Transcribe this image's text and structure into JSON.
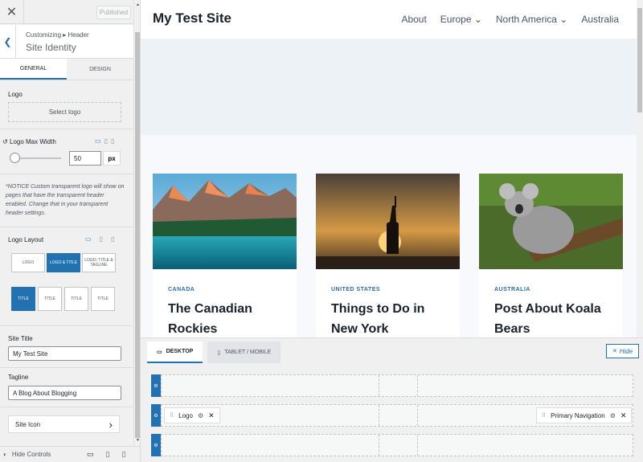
{
  "panel": {
    "close_glyph": "✕",
    "published_label": "Published",
    "back_glyph": "❮",
    "breadcrumb": "Customizing ▸ Header",
    "section_title": "Site Identity",
    "tabs": {
      "general": "GENERAL",
      "design": "DESIGN"
    },
    "logo_label": "Logo",
    "select_logo": "Select logo",
    "logo_max_width_label": "Logo Max Width",
    "logo_max_width_value": "50",
    "unit": "px",
    "notice": "*NOTICE Custom transparent logo will show on pages that have the transparent header enabled. Change that in your transparent header settings.",
    "logo_layout_label": "Logo Layout",
    "layout_options": [
      "LOGO",
      "LOGO & TITLE",
      "LOGO; TITLE & TAGLINE"
    ],
    "align_options": [
      "TITLE",
      "TITLE",
      "TITLE",
      "TITLE"
    ],
    "site_title_label": "Site Title",
    "site_title_value": "My Test Site",
    "tagline_label": "Tagline",
    "tagline_value": "A Blog About Blogging",
    "site_icon_label": "Site Icon",
    "chevron_right": "›",
    "hide_controls": "Hide Controls"
  },
  "site": {
    "title": "My Test Site",
    "nav": [
      "About",
      "Europe ⌄",
      "North America ⌄",
      "Australia"
    ],
    "cards": [
      {
        "category": "CANADA",
        "title": "The Canadian Rockies"
      },
      {
        "category": "UNITED STATES",
        "title": "Things to Do in New York"
      },
      {
        "category": "AUSTRALIA",
        "title": "Post About Koala Bears"
      }
    ]
  },
  "builder": {
    "tab_desktop": "DESKTOP",
    "tab_tablet": "TABLET / MOBILE",
    "hide_label": "Hide",
    "hide_glyph": "✕",
    "logo_chip": "Logo",
    "nav_chip": "Primary Navigation"
  },
  "colors": {
    "accent": "#2271b1",
    "category": "#2b6cb0"
  }
}
